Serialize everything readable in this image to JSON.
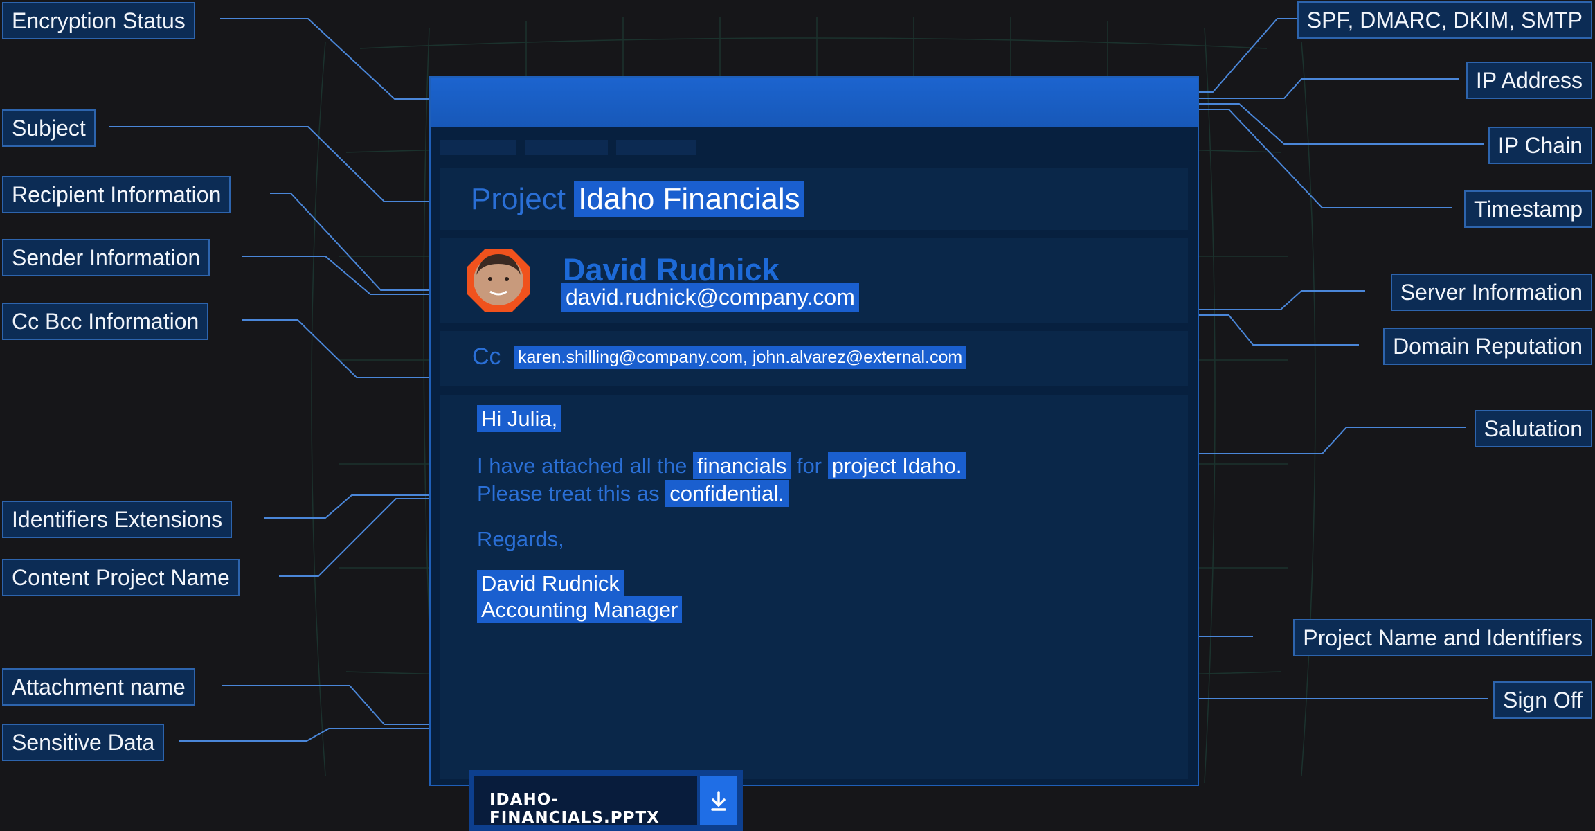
{
  "email": {
    "subject_prefix": "Project",
    "subject_main": "Idaho Financials",
    "sender_name": "David Rudnick",
    "sender_email": "david.rudnick@company.com",
    "cc_label": "Cc",
    "cc_value": "karen.shilling@company.com, john.alvarez@external.com",
    "salutation": "Hi Julia,",
    "line1_a": "I have attached all the",
    "line1_b": "financials",
    "line1_c": "for",
    "line1_d": "project Idaho.",
    "line2_a": "Please treat this as",
    "line2_b": "confidential.",
    "regards": "Regards,",
    "signoff_name": "David Rudnick",
    "signoff_title": "Accounting Manager",
    "attachment_name": "IDAHO-FINANCIALS.PPTX",
    "download_icon": "download-icon"
  },
  "labels": {
    "encryption_status": "Encryption Status",
    "subject": "Subject",
    "recipient_information": "Recipient Information",
    "sender_information": "Sender Information",
    "cc_bcc_information": "Cc Bcc Information",
    "identifiers_extensions": "Identifiers Extensions",
    "content_project_name": "Content Project Name",
    "attachment_name": "Attachment name",
    "sensitive_data": "Sensitive Data",
    "spf_dmarc": "SPF, DMARC, DKIM, SMTP",
    "ip_address": "IP Address",
    "ip_chain": "IP Chain",
    "timestamp": "Timestamp",
    "server_information": "Server Information",
    "domain_reputation": "Domain Reputation",
    "salutation": "Salutation",
    "project_name_identifiers": "Project Name and Identifiers",
    "sign_off": "Sign Off"
  },
  "colors": {
    "background": "#161619",
    "card": "#07203f",
    "header": "#1c64cf",
    "highlight": "#1a5fcf",
    "label_bg": "#0c2c55",
    "line": "#4a86d8",
    "avatar_ring": "#f0521d"
  }
}
